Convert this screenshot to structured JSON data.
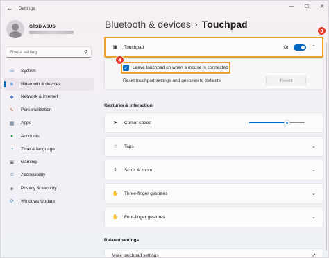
{
  "window": {
    "app_title": "Settings",
    "controls": {
      "minimize": "—",
      "maximize": "☐",
      "close": "✕"
    }
  },
  "profile": {
    "name": "GTSD ASUS"
  },
  "nav_search": {
    "placeholder": "Find a setting"
  },
  "nav": {
    "items": [
      {
        "label": "System",
        "icon": "monitor-icon",
        "glyph": "▭",
        "color": "#3a8ad8",
        "active": false
      },
      {
        "label": "Bluetooth & devices",
        "icon": "bluetooth-icon",
        "glyph": "ʙ",
        "color": "#0067c0",
        "active": true
      },
      {
        "label": "Network & internet",
        "icon": "network-icon",
        "glyph": "◆",
        "color": "#4b7bbf",
        "active": false
      },
      {
        "label": "Personalization",
        "icon": "brush-icon",
        "glyph": "✎",
        "color": "#c36b3f",
        "active": false
      },
      {
        "label": "Apps",
        "icon": "apps-icon",
        "glyph": "▦",
        "color": "#5a6b85",
        "active": false
      },
      {
        "label": "Accounts",
        "icon": "person-icon",
        "glyph": "●",
        "color": "#2e9d5a",
        "active": false
      },
      {
        "label": "Time & language",
        "icon": "globe-clock-icon",
        "glyph": "◔",
        "color": "#2f7fbf",
        "active": false
      },
      {
        "label": "Gaming",
        "icon": "gamepad-icon",
        "glyph": "▣",
        "color": "#6c6c6c",
        "active": false
      },
      {
        "label": "Accessibility",
        "icon": "accessibility-icon",
        "glyph": "☺",
        "color": "#2f6fb0",
        "active": false
      },
      {
        "label": "Privacy & security",
        "icon": "shield-icon",
        "glyph": "◈",
        "color": "#6b6b6b",
        "active": false
      },
      {
        "label": "Windows Update",
        "icon": "update-icon",
        "glyph": "⟳",
        "color": "#2f7fbf",
        "active": false
      }
    ]
  },
  "breadcrumb": {
    "parent": "Bluetooth & devices",
    "separator": "›",
    "current": "Touchpad"
  },
  "touchpad": {
    "label": "Touchpad",
    "toggle_state": "On",
    "toggle_on": true,
    "leave_on_label": "Leave touchpad on when a mouse is connected",
    "leave_on_checked": true,
    "reset_label": "Reset touchpad settings and gestures to defaults",
    "reset_button": "Reset"
  },
  "annotations": {
    "badge_3": "3",
    "badge_4": "4",
    "highlight_color": "#e9a22c",
    "badge_color": "#e5392c"
  },
  "gestures": {
    "section_title": "Gestures & interaction",
    "cursor_speed": {
      "label": "Cursor speed",
      "level_percent": 70
    },
    "rows": [
      {
        "label": "Taps",
        "icon": "tap-icon"
      },
      {
        "label": "Scroll & zoom",
        "icon": "scroll-zoom-icon"
      },
      {
        "label": "Three-finger gestures",
        "icon": "three-finger-icon"
      },
      {
        "label": "Four-finger gestures",
        "icon": "four-finger-icon"
      }
    ]
  },
  "related": {
    "section_title": "Related settings",
    "more_label": "More touchpad settings"
  },
  "colors": {
    "accent": "#0067c0"
  }
}
